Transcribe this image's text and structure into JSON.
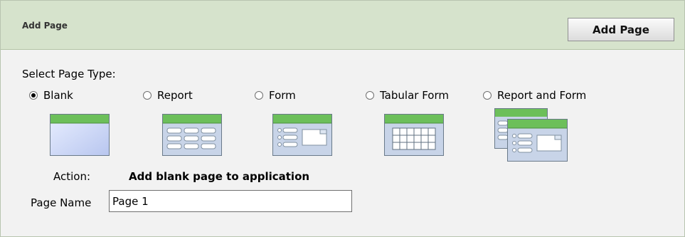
{
  "header": {
    "title": "Add Page",
    "add_button_label": "Add Page"
  },
  "select_page_type": {
    "label": "Select Page Type:",
    "options": [
      {
        "label": "Blank",
        "selected": true,
        "icon": "blank-page-icon"
      },
      {
        "label": "Report",
        "selected": false,
        "icon": "report-page-icon"
      },
      {
        "label": "Form",
        "selected": false,
        "icon": "form-page-icon"
      },
      {
        "label": "Tabular Form",
        "selected": false,
        "icon": "tabular-form-page-icon"
      },
      {
        "label": "Report and Form",
        "selected": false,
        "icon": "report-and-form-page-icon"
      }
    ]
  },
  "action": {
    "label": "Action:",
    "value": "Add blank page to application"
  },
  "page_name": {
    "label": "Page Name",
    "value": "Page 1"
  },
  "colors": {
    "header_bg": "#d6e3cc",
    "icon_green": "#66bb55",
    "icon_body": "#c8d8ee"
  }
}
